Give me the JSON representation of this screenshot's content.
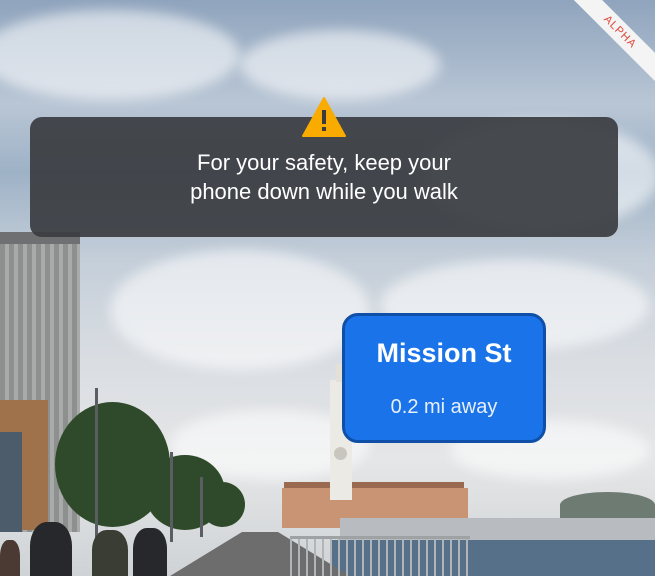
{
  "ribbon": {
    "label": "ALPHA"
  },
  "safety_warning": {
    "icon": "warning-triangle-icon",
    "icon_color": "#f9ab00",
    "message": "For your safety, keep your\nphone down while you walk"
  },
  "destination": {
    "name": "Mission St",
    "distance": "0.2 mi away",
    "accent_color": "#1a73e8"
  }
}
